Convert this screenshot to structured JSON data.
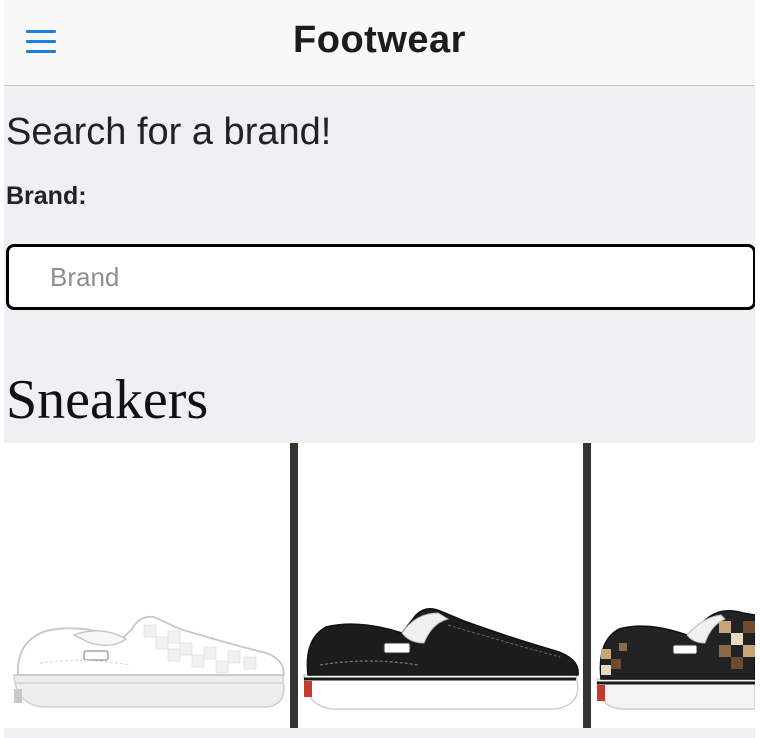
{
  "header": {
    "title": "Footwear",
    "menu_icon": "hamburger-menu-icon",
    "accent_color": "#1b7fe0"
  },
  "search": {
    "heading": "Search for a brand!",
    "label": "Brand:",
    "input_value": "",
    "placeholder": "Brand"
  },
  "section": {
    "title": "Sneakers",
    "products": [
      {
        "name": "white checkerboard slip-on sneaker",
        "color": "white"
      },
      {
        "name": "black canvas slip-on sneaker",
        "color": "black"
      },
      {
        "name": "camo checkerboard slip-on sneaker",
        "color": "camo"
      }
    ]
  }
}
